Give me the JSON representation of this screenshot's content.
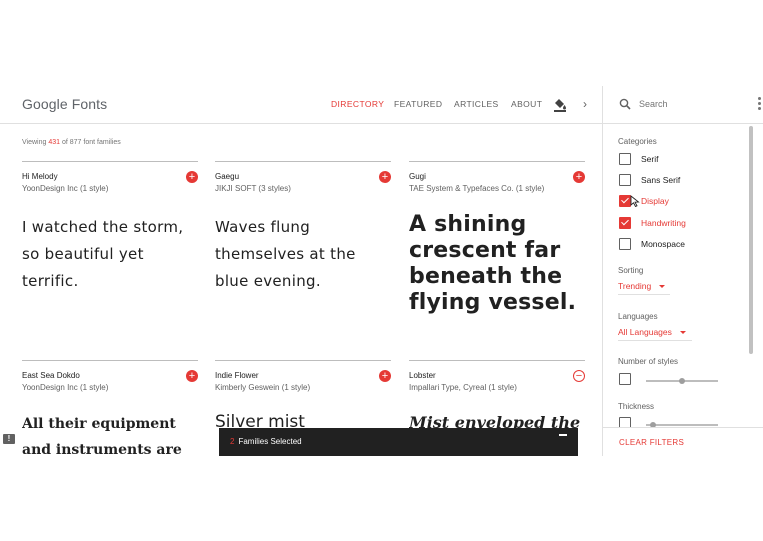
{
  "header": {
    "logo": "Google Fonts",
    "nav": [
      "DIRECTORY",
      "FEATURED",
      "ARTICLES",
      "ABOUT"
    ],
    "active_nav": "DIRECTORY",
    "search_placeholder": "Search"
  },
  "viewing": {
    "prefix": "Viewing ",
    "shown": "431",
    "suffix": " of 877 font families"
  },
  "cards": [
    {
      "name": "Hi Melody",
      "designer": "YoonDesign Inc (1 style)",
      "sample_lines": [
        "I watched the storm,",
        "so beautiful yet",
        "terrific."
      ],
      "selected": false
    },
    {
      "name": "Gaegu",
      "designer": "JIKJI SOFT (3 styles)",
      "sample_lines": [
        "Waves flung",
        "themselves at the",
        "blue evening."
      ],
      "selected": false
    },
    {
      "name": "Gugi",
      "designer": "TAE System & Typefaces Co. (1 style)",
      "sample_lines": [
        "A shining",
        "crescent far",
        "beneath the",
        "flying vessel."
      ],
      "selected": false
    },
    {
      "name": "East Sea Dokdo",
      "designer": "YoonDesign Inc (1 style)",
      "sample_lines": [
        "All their equipment",
        "and instruments are"
      ],
      "selected": false
    },
    {
      "name": "Indie Flower",
      "designer": "Kimberly Geswein (1 style)",
      "sample_lines": [
        "Silver mist"
      ],
      "selected": false
    },
    {
      "name": "Lobster",
      "designer": "Impallari Type, Cyreal (1 style)",
      "sample_lines": [
        "Mist enveloped the"
      ],
      "selected": true
    }
  ],
  "add_symbol": "+",
  "remove_symbol": "−",
  "families_bar": {
    "count": "2",
    "label": "Families Selected"
  },
  "sidebar": {
    "categories_label": "Categories",
    "categories": [
      {
        "label": "Serif",
        "checked": false
      },
      {
        "label": "Sans Serif",
        "checked": false
      },
      {
        "label": "Display",
        "checked": true
      },
      {
        "label": "Handwriting",
        "checked": true
      },
      {
        "label": "Monospace",
        "checked": false
      }
    ],
    "sorting_label": "Sorting",
    "sorting_value": "Trending",
    "languages_label": "Languages",
    "languages_value": "All Languages",
    "styles_label": "Number of styles",
    "thickness_label": "Thickness",
    "clear_filters": "CLEAR FILTERS"
  },
  "colors": {
    "accent": "#e53935",
    "text": "#212121",
    "bar": "#212121"
  }
}
